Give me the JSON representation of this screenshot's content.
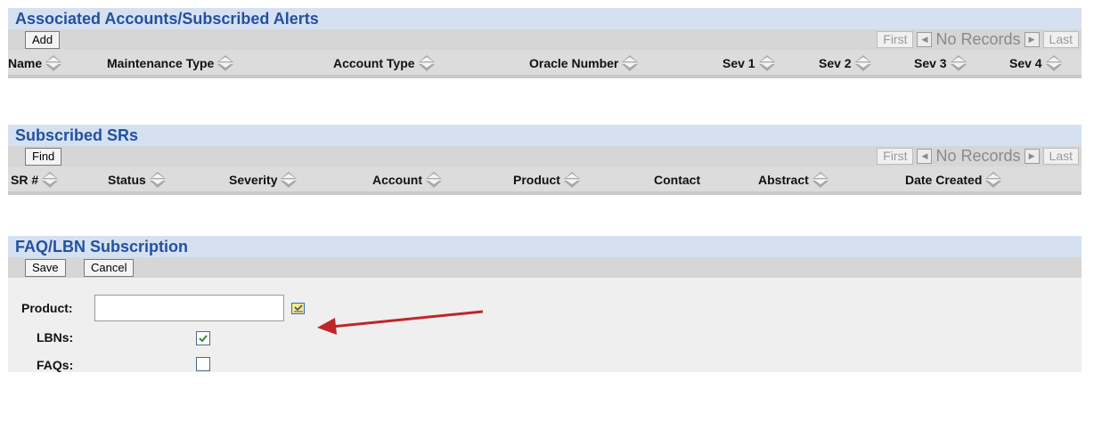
{
  "accounts_section": {
    "title": "Associated Accounts/Subscribed Alerts",
    "add_label": "Add",
    "pager": {
      "first": "First",
      "status": "No Records",
      "last": "Last"
    },
    "columns": [
      "Name",
      "Maintenance Type",
      "Account Type",
      "Oracle Number",
      "Sev 1",
      "Sev 2",
      "Sev 3",
      "Sev 4"
    ]
  },
  "srs_section": {
    "title": "Subscribed SRs",
    "find_label": "Find",
    "pager": {
      "first": "First",
      "status": "No Records",
      "last": "Last"
    },
    "columns": [
      "SR #",
      "Status",
      "Severity",
      "Account",
      "Product",
      "Contact",
      "Abstract",
      "Date Created"
    ]
  },
  "faq_section": {
    "title": "FAQ/LBN Subscription",
    "save_label": "Save",
    "cancel_label": "Cancel",
    "product_label": "Product:",
    "product_value": "",
    "lbns_label": "LBNs:",
    "lbns_checked": true,
    "faqs_label": "FAQs:",
    "faqs_checked": false
  },
  "colors": {
    "title_text": "#2450a0",
    "title_bg": "#d5e1f1",
    "toolbar_bg": "#d6d6d6",
    "annotation_arrow": "#c0262a",
    "checkbox_check": "#2e8b3a"
  },
  "icons": {
    "pager_prev": "triangle-left-icon",
    "pager_next": "triangle-right-icon",
    "sort": "sort-arrows-icon",
    "product_picker": "list-picker-icon"
  }
}
